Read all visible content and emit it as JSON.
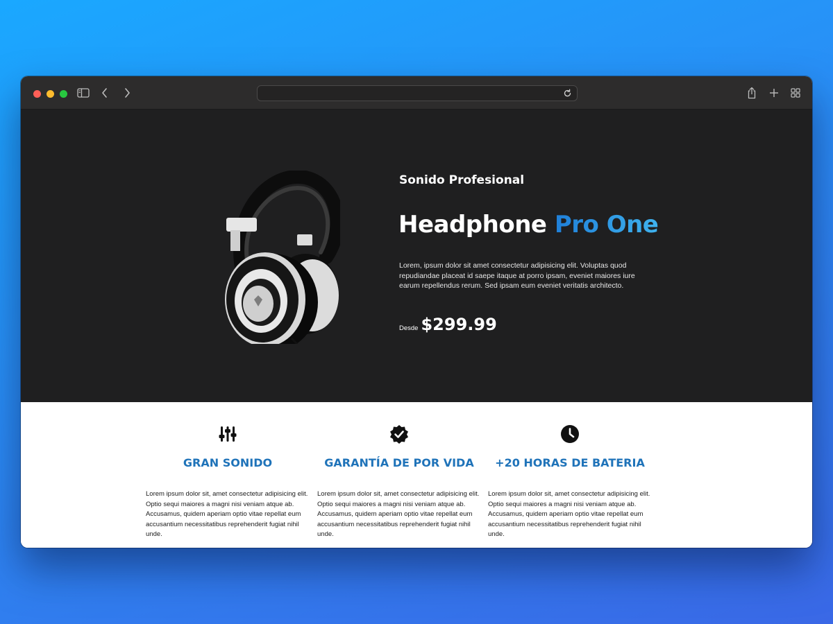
{
  "browser": {
    "traffic_lights": [
      "#ff5f57",
      "#febc2e",
      "#28c840"
    ],
    "address": ""
  },
  "hero": {
    "eyebrow": "Sonido Profesional",
    "title_main": "Headphone",
    "title_accent": "Pro One",
    "description": "Lorem, ipsum dolor sit amet consectetur adipisicing elit. Voluptas quod repudiandae placeat id saepe itaque at porro ipsam, eveniet maiores iure earum repellendus rerum. Sed ipsam eum eveniet veritatis architecto.",
    "price_label": "Desde",
    "price": "$299.99",
    "accent_colors": [
      "#1f7fd8",
      "#3fb2ee"
    ]
  },
  "features": [
    {
      "icon": "sliders-icon",
      "title": "GRAN SONIDO",
      "text": "Lorem ipsum dolor sit, amet consectetur adipisicing elit. Optio sequi maiores a magni nisi veniam atque ab. Accusamus, quidem aperiam optio vitae repellat eum accusantium necessitatibus reprehenderit fugiat nihil unde."
    },
    {
      "icon": "verified-badge-icon",
      "title": "GARANTÍA DE POR VIDA",
      "text": "Lorem ipsum dolor sit, amet consectetur adipisicing elit. Optio sequi maiores a magni nisi veniam atque ab. Accusamus, quidem aperiam optio vitae repellat eum accusantium necessitatibus reprehenderit fugiat nihil unde."
    },
    {
      "icon": "clock-icon",
      "title": "+20 HORAS DE BATERIA",
      "text": "Lorem ipsum dolor sit, amet consectetur adipisicing elit. Optio sequi maiores a magni nisi veniam atque ab. Accusamus, quidem aperiam optio vitae repellat eum accusantium necessitatibus reprehenderit fugiat nihil unde."
    }
  ],
  "colors": {
    "feature_title": "#1f73b9",
    "hero_background": "#1f1f20"
  }
}
